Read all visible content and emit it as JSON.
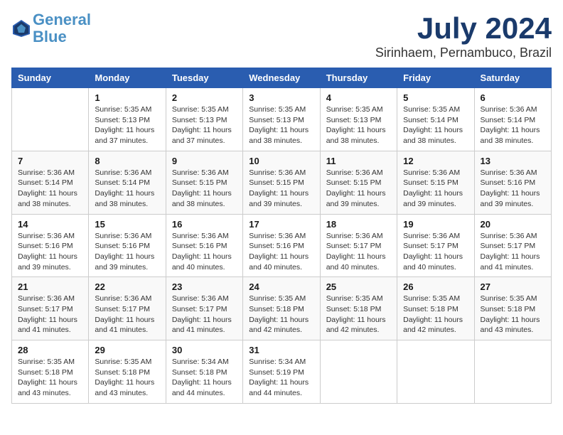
{
  "header": {
    "logo_line1": "General",
    "logo_line2": "Blue",
    "title": "July 2024",
    "subtitle": "Sirinhaem, Pernambuco, Brazil"
  },
  "columns": [
    "Sunday",
    "Monday",
    "Tuesday",
    "Wednesday",
    "Thursday",
    "Friday",
    "Saturday"
  ],
  "weeks": [
    [
      {
        "day": "",
        "info": ""
      },
      {
        "day": "1",
        "info": "Sunrise: 5:35 AM\nSunset: 5:13 PM\nDaylight: 11 hours\nand 37 minutes."
      },
      {
        "day": "2",
        "info": "Sunrise: 5:35 AM\nSunset: 5:13 PM\nDaylight: 11 hours\nand 37 minutes."
      },
      {
        "day": "3",
        "info": "Sunrise: 5:35 AM\nSunset: 5:13 PM\nDaylight: 11 hours\nand 38 minutes."
      },
      {
        "day": "4",
        "info": "Sunrise: 5:35 AM\nSunset: 5:13 PM\nDaylight: 11 hours\nand 38 minutes."
      },
      {
        "day": "5",
        "info": "Sunrise: 5:35 AM\nSunset: 5:14 PM\nDaylight: 11 hours\nand 38 minutes."
      },
      {
        "day": "6",
        "info": "Sunrise: 5:36 AM\nSunset: 5:14 PM\nDaylight: 11 hours\nand 38 minutes."
      }
    ],
    [
      {
        "day": "7",
        "info": "Sunrise: 5:36 AM\nSunset: 5:14 PM\nDaylight: 11 hours\nand 38 minutes."
      },
      {
        "day": "8",
        "info": "Sunrise: 5:36 AM\nSunset: 5:14 PM\nDaylight: 11 hours\nand 38 minutes."
      },
      {
        "day": "9",
        "info": "Sunrise: 5:36 AM\nSunset: 5:15 PM\nDaylight: 11 hours\nand 38 minutes."
      },
      {
        "day": "10",
        "info": "Sunrise: 5:36 AM\nSunset: 5:15 PM\nDaylight: 11 hours\nand 39 minutes."
      },
      {
        "day": "11",
        "info": "Sunrise: 5:36 AM\nSunset: 5:15 PM\nDaylight: 11 hours\nand 39 minutes."
      },
      {
        "day": "12",
        "info": "Sunrise: 5:36 AM\nSunset: 5:15 PM\nDaylight: 11 hours\nand 39 minutes."
      },
      {
        "day": "13",
        "info": "Sunrise: 5:36 AM\nSunset: 5:16 PM\nDaylight: 11 hours\nand 39 minutes."
      }
    ],
    [
      {
        "day": "14",
        "info": "Sunrise: 5:36 AM\nSunset: 5:16 PM\nDaylight: 11 hours\nand 39 minutes."
      },
      {
        "day": "15",
        "info": "Sunrise: 5:36 AM\nSunset: 5:16 PM\nDaylight: 11 hours\nand 39 minutes."
      },
      {
        "day": "16",
        "info": "Sunrise: 5:36 AM\nSunset: 5:16 PM\nDaylight: 11 hours\nand 40 minutes."
      },
      {
        "day": "17",
        "info": "Sunrise: 5:36 AM\nSunset: 5:16 PM\nDaylight: 11 hours\nand 40 minutes."
      },
      {
        "day": "18",
        "info": "Sunrise: 5:36 AM\nSunset: 5:17 PM\nDaylight: 11 hours\nand 40 minutes."
      },
      {
        "day": "19",
        "info": "Sunrise: 5:36 AM\nSunset: 5:17 PM\nDaylight: 11 hours\nand 40 minutes."
      },
      {
        "day": "20",
        "info": "Sunrise: 5:36 AM\nSunset: 5:17 PM\nDaylight: 11 hours\nand 41 minutes."
      }
    ],
    [
      {
        "day": "21",
        "info": "Sunrise: 5:36 AM\nSunset: 5:17 PM\nDaylight: 11 hours\nand 41 minutes."
      },
      {
        "day": "22",
        "info": "Sunrise: 5:36 AM\nSunset: 5:17 PM\nDaylight: 11 hours\nand 41 minutes."
      },
      {
        "day": "23",
        "info": "Sunrise: 5:36 AM\nSunset: 5:17 PM\nDaylight: 11 hours\nand 41 minutes."
      },
      {
        "day": "24",
        "info": "Sunrise: 5:35 AM\nSunset: 5:18 PM\nDaylight: 11 hours\nand 42 minutes."
      },
      {
        "day": "25",
        "info": "Sunrise: 5:35 AM\nSunset: 5:18 PM\nDaylight: 11 hours\nand 42 minutes."
      },
      {
        "day": "26",
        "info": "Sunrise: 5:35 AM\nSunset: 5:18 PM\nDaylight: 11 hours\nand 42 minutes."
      },
      {
        "day": "27",
        "info": "Sunrise: 5:35 AM\nSunset: 5:18 PM\nDaylight: 11 hours\nand 43 minutes."
      }
    ],
    [
      {
        "day": "28",
        "info": "Sunrise: 5:35 AM\nSunset: 5:18 PM\nDaylight: 11 hours\nand 43 minutes."
      },
      {
        "day": "29",
        "info": "Sunrise: 5:35 AM\nSunset: 5:18 PM\nDaylight: 11 hours\nand 43 minutes."
      },
      {
        "day": "30",
        "info": "Sunrise: 5:34 AM\nSunset: 5:18 PM\nDaylight: 11 hours\nand 44 minutes."
      },
      {
        "day": "31",
        "info": "Sunrise: 5:34 AM\nSunset: 5:19 PM\nDaylight: 11 hours\nand 44 minutes."
      },
      {
        "day": "",
        "info": ""
      },
      {
        "day": "",
        "info": ""
      },
      {
        "day": "",
        "info": ""
      }
    ]
  ]
}
